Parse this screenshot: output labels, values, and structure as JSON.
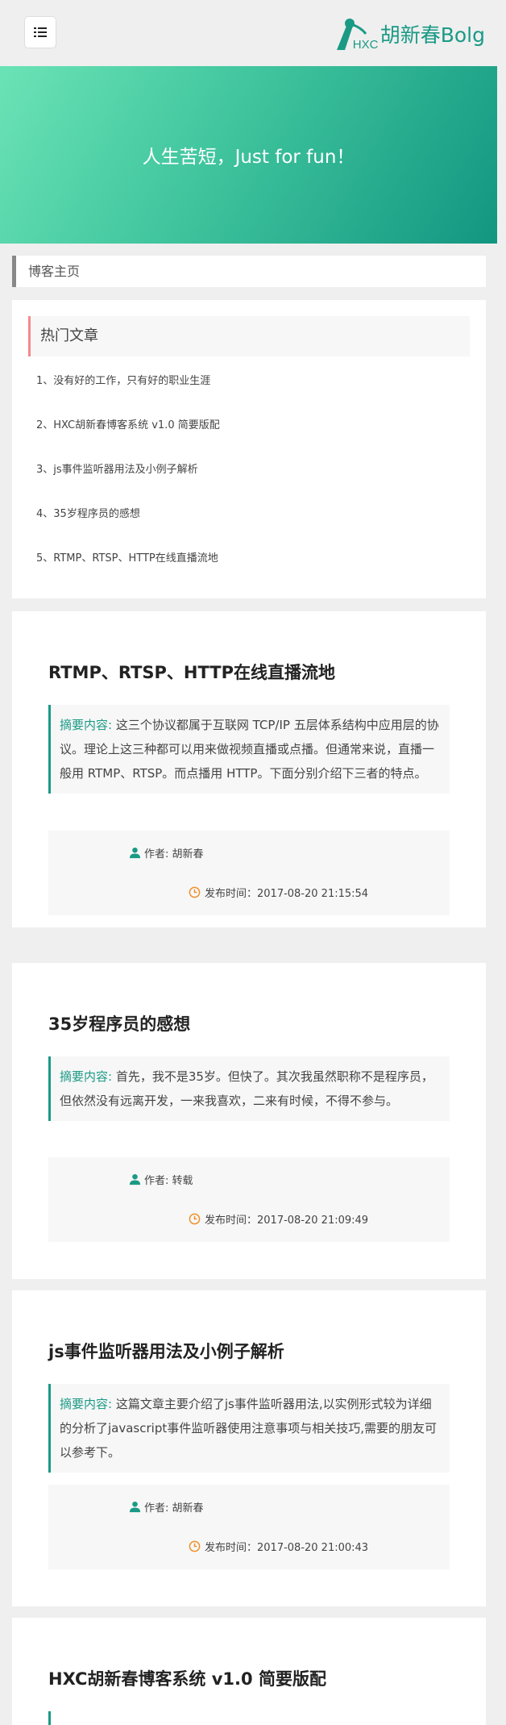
{
  "header": {
    "menu_icon": "list-icon",
    "logo_mark": "HXC",
    "logo_text": "胡新春Bolg",
    "brand_color": "#1a9a85"
  },
  "banner": {
    "slogan": "人生苦短，Just for fun！"
  },
  "breadcrumb": {
    "label": "博客主页"
  },
  "hot": {
    "title": "热门文章",
    "items": [
      "1、没有好的工作，只有好的职业生涯",
      "2、HXC胡新春博客系统 v1.0 简要版配",
      "3、js事件监听器用法及小例子解析",
      "4、35岁程序员的感想",
      "5、RTMP、RTSP、HTTP在线直播流地"
    ]
  },
  "articles": [
    {
      "title": "RTMP、RTSP、HTTP在线直播流地",
      "summary_label": "摘要内容:",
      "summary": " 这三个协议都属于互联网 TCP/IP 五层体系结构中应用层的协议。理论上这三种都可以用来做视频直播或点播。但通常来说，直播一般用 RTMP、RTSP。而点播用 HTTP。下面分别介绍下三者的特点。",
      "author": "作者: 胡新春",
      "time": "发布时间：2017-08-20 21:15:54"
    },
    {
      "title": "35岁程序员的感想",
      "summary_label": "摘要内容:",
      "summary": " 首先，我不是35岁。但快了。其次我虽然职称不是程序员，但依然没有远离开发，一来我喜欢，二来有时候，不得不参与。",
      "author": "作者: 转载",
      "time": "发布时间：2017-08-20 21:09:49"
    },
    {
      "title": "js事件监听器用法及小例子解析",
      "summary_label": "摘要内容:",
      "summary": " 这篇文章主要介绍了js事件监听器用法,以实例形式较为详细的分析了javascript事件监听器使用注意事项与相关技巧,需要的朋友可以参考下。",
      "author": "作者: 胡新春",
      "time": "发布时间：2017-08-20 21:00:43"
    },
    {
      "title": "HXC胡新春博客系统 v1.0 简要版配"
    }
  ]
}
